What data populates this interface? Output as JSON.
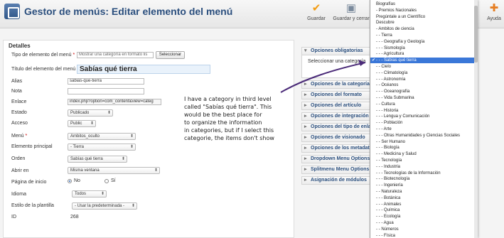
{
  "header": {
    "title": "Gestor de menús: Editar elemento del menú",
    "toolbar": {
      "save_label": "Guardar",
      "save_close_label": "Guardar y cerrar",
      "help_label": "Ayuda"
    }
  },
  "details": {
    "legend": "Detalles",
    "fields": {
      "tipo_label": "Tipo de elemento del menú",
      "tipo_value": "Mostrar una categoría en formato lis",
      "tipo_button": "Seleccionar",
      "titulo_label": "Título del elemento del menú",
      "titulo_value": "Sabías qué tierra",
      "alias_label": "Alias",
      "alias_value": "sabias-que-tierra",
      "nota_label": "Nota",
      "nota_value": "",
      "enlace_label": "Enlace",
      "enlace_value": "index.php?option=com_content&view=categ",
      "estado_label": "Estado",
      "estado_value": "Publicado",
      "acceso_label": "Acceso",
      "acceso_value": "Public",
      "menu_label": "Menú",
      "menu_value": "Ambitos_oculto",
      "principal_label": "Elemento principal",
      "principal_value": "- Tierra",
      "orden_label": "Orden",
      "orden_value": "Sabías qué tierra",
      "abrir_label": "Abrir en",
      "abrir_value": "Misma ventana",
      "inicio_label": "Página de inicio",
      "inicio_no": "No",
      "inicio_si": "Sí",
      "idioma_label": "Idioma",
      "idioma_value": "Todos",
      "estilo_label": "Estilo de la plantilla",
      "estilo_value": "- Usar la predeterminada -",
      "id_label": "ID",
      "id_value": "268"
    }
  },
  "annotation": {
    "lines": [
      "I have a category in third level",
      "called \"Sabías qué tierra\". This",
      "would be the best place for",
      "to organize the information",
      "in categories, but if I select this",
      "categorie, the items don't show"
    ]
  },
  "right_panel": {
    "open_title": "Opciones obligatorias",
    "open_body": "Seleccionar una categoría",
    "sections": [
      "Opciones de la categoría",
      "Opciones del formato",
      "Opciones del artículo",
      "Opciones de integración",
      "Opciones del tipo de enlace",
      "Opciones de visionado",
      "Opciones de los metadatos",
      "Dropdown Menu Options",
      "Splitmenu Menu Options",
      "Asignación de módulos"
    ]
  },
  "dropdown": {
    "selected_index": 10,
    "items": [
      "Biografías",
      "- Premios Nacionales",
      "Pregúntale a un Científico",
      "Descubre",
      "- Ambitos de ciencia",
      "- - Tierra",
      "- - - Geografía y Geología",
      "- - - Sismología",
      "- - - Agricultura",
      "- - - Sabías qué tierra",
      "- - Cielo",
      "- - - Climatología",
      "- - - Astronomía",
      "- - Océanos",
      "- - - Oceanografía",
      "- - - Vida Submarina",
      "- - Cultura",
      "- - - Historia",
      "- - - Lengua y Comunicación",
      "- - - Población",
      "- - - Arte",
      "- - - Otras Humanidades y Ciencias Sociales",
      "- - Ser Humano",
      "- - - Biología",
      "- - - Medicina y Salud",
      "- - Tecnología",
      "- - - Industria",
      "- - - Tecnologías de la Información",
      "- - - Biotecnología",
      "- - - Ingeniería",
      "- - Naturaleza",
      "- - - Botánica",
      "- - - Animales",
      "- - - Química",
      "- - - Ecología",
      "- - - Agua",
      "- - Números",
      "- - - Física"
    ]
  },
  "colors": {
    "title": "#2a4e7d",
    "selected_item": "#3a77d8",
    "annotation_arrow": "#4a2a78"
  }
}
